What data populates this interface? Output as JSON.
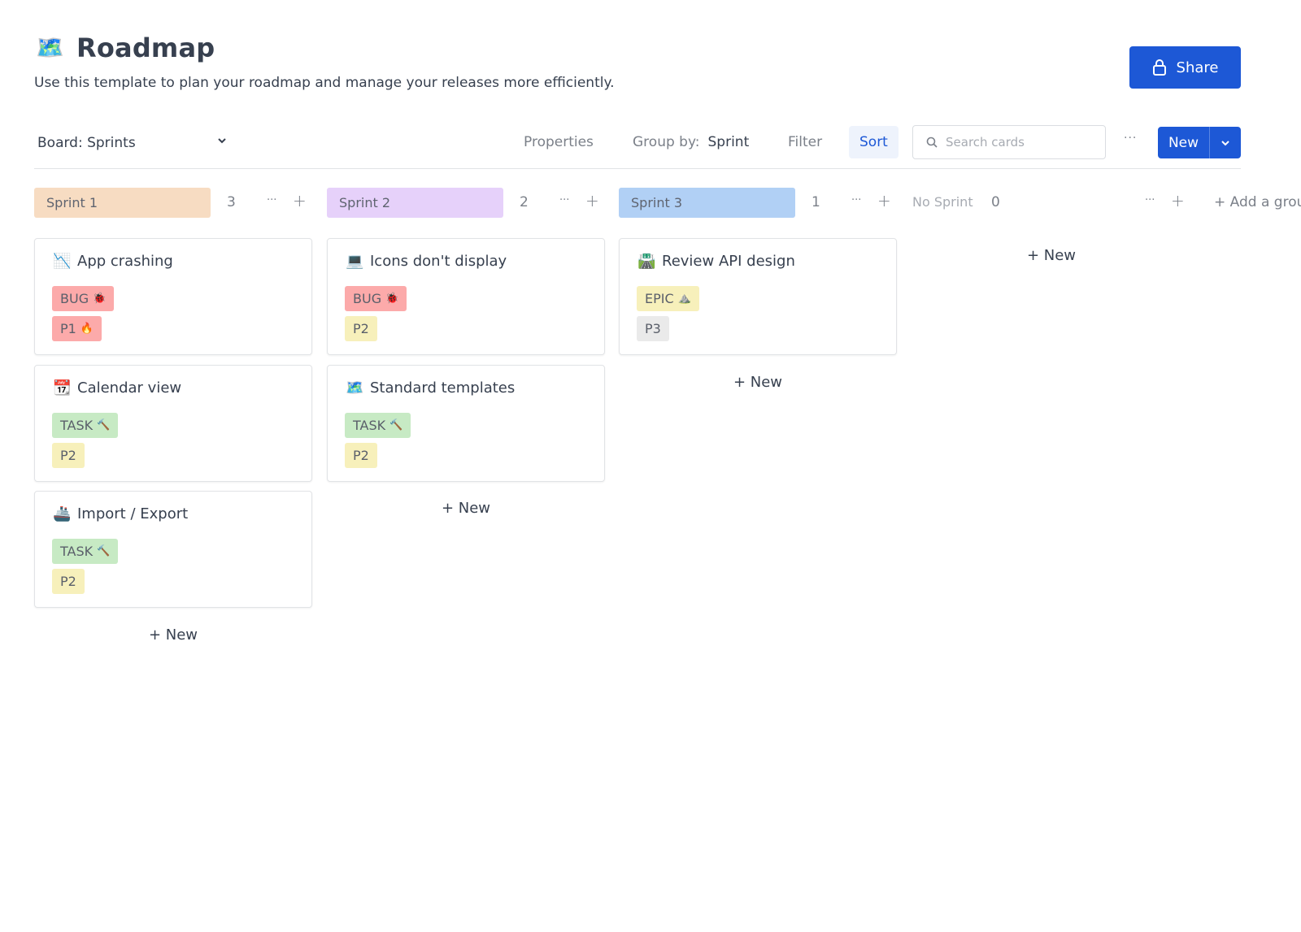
{
  "header": {
    "icon": "world-map-icon",
    "icon_glyph": "🗺️",
    "title": "Roadmap",
    "subtitle": "Use this template to plan your roadmap and manage your releases more efficiently.",
    "share_label": "Share"
  },
  "toolbar": {
    "board_select": "Board: Sprints",
    "properties": "Properties",
    "group_by_label": "Group by:",
    "group_by_value": "Sprint",
    "filter": "Filter",
    "sort": "Sort",
    "search_placeholder": "Search cards",
    "search_value": "",
    "more": "···",
    "new_label": "New"
  },
  "colors": {
    "accent": "#1d58d6",
    "sprint1": "#f7dcc2",
    "sprint2": "#e6d1fa",
    "sprint3": "#b1d0f5",
    "bug": "#fcaaaa",
    "task": "#c7eac4",
    "epic": "#f7f0bb",
    "p1": "#fcaaaa",
    "p2": "#f7f0bb",
    "p3": "#eaeaea"
  },
  "columns": [
    {
      "name": "Sprint 1",
      "count": "3",
      "more": "···",
      "add": "+",
      "cards": [
        {
          "icon": "chart-decreasing-icon",
          "glyph": "📉",
          "title": "App crashing",
          "type": "BUG",
          "type_emoji": "🐞",
          "priority": "P1",
          "priority_emoji": "🔥"
        },
        {
          "icon": "calendar-icon",
          "glyph": "📆",
          "title": "Calendar view",
          "type": "TASK",
          "type_emoji": "🔨",
          "priority": "P2",
          "priority_emoji": ""
        },
        {
          "icon": "ship-icon",
          "glyph": "🚢",
          "title": "Import / Export",
          "type": "TASK",
          "type_emoji": "🔨",
          "priority": "P2",
          "priority_emoji": ""
        }
      ],
      "new_label": "+ New"
    },
    {
      "name": "Sprint 2",
      "count": "2",
      "more": "···",
      "add": "+",
      "cards": [
        {
          "icon": "laptop-icon",
          "glyph": "💻",
          "title": "Icons don't display",
          "type": "BUG",
          "type_emoji": "🐞",
          "priority": "P2",
          "priority_emoji": ""
        },
        {
          "icon": "world-map-icon",
          "glyph": "🗺️",
          "title": "Standard templates",
          "type": "TASK",
          "type_emoji": "🔨",
          "priority": "P2",
          "priority_emoji": ""
        }
      ],
      "new_label": "+ New"
    },
    {
      "name": "Sprint 3",
      "count": "1",
      "more": "···",
      "add": "+",
      "cards": [
        {
          "icon": "motorway-icon",
          "glyph": "🛣️",
          "title": "Review API design",
          "type": "EPIC",
          "type_emoji": "⛰️",
          "priority": "P3",
          "priority_emoji": ""
        }
      ],
      "new_label": "+ New"
    },
    {
      "name": "No Sprint",
      "count": "0",
      "more": "···",
      "add": "+",
      "cards": [],
      "new_label": "+ New"
    }
  ],
  "add_group_label": "+ Add a group"
}
